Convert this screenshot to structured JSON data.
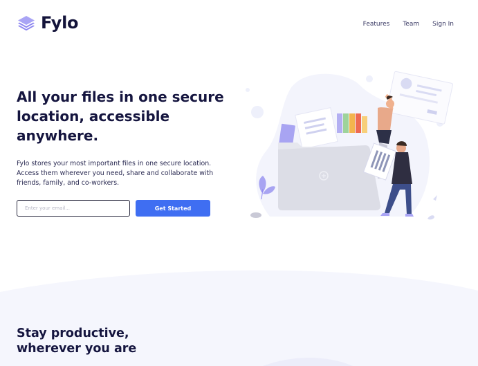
{
  "header": {
    "logo_text": "Fylo",
    "nav": [
      "Features",
      "Team",
      "Sign In"
    ]
  },
  "hero": {
    "title": "All your files in one secure location, accessible anywhere.",
    "description": "Fylo stores your most important files in one secure location. Access them wherever you need, share and collaborate with friends, family, and co-workers.",
    "email_placeholder": "Enter your email...",
    "cta_label": "Get Started"
  },
  "productive": {
    "title": "Stay productive, wherever you are"
  },
  "colors": {
    "accent": "#3f6ef2",
    "heading": "#15153f",
    "section_bg": "#f5f6fd"
  },
  "icons": [
    "logo-stack-icon",
    "hero-illustration"
  ]
}
